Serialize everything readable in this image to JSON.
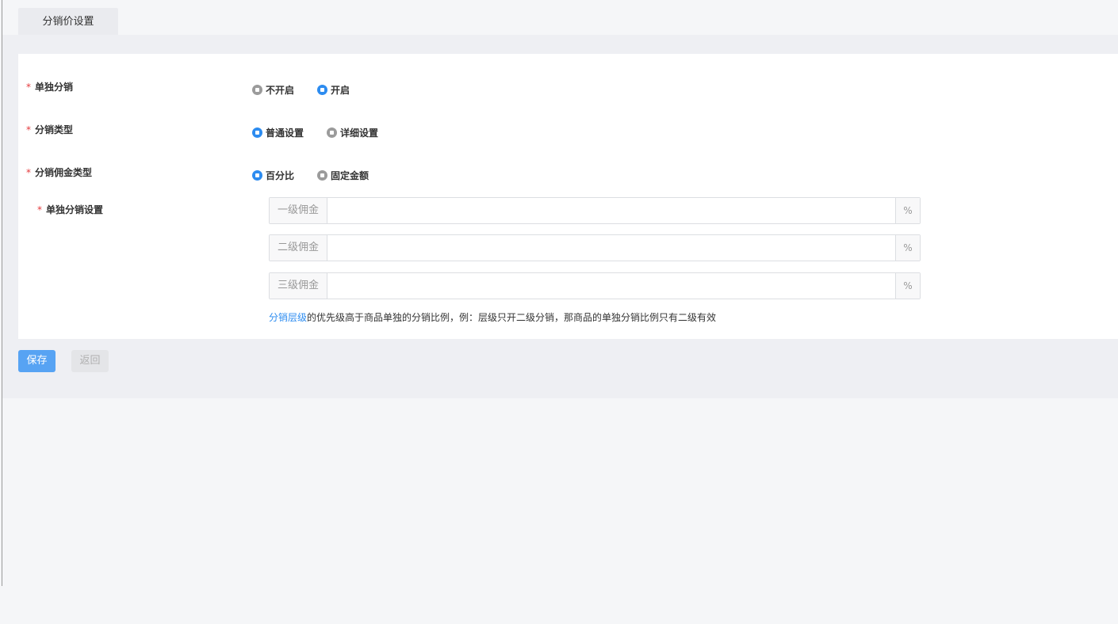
{
  "tab": {
    "label": "分销价设置"
  },
  "form": {
    "single_distribution": {
      "label": "单独分销",
      "options": [
        "不开启",
        "开启"
      ],
      "selected": "开启"
    },
    "distribution_type": {
      "label": "分销类型",
      "options": [
        "普通设置",
        "详细设置"
      ],
      "selected": "普通设置"
    },
    "commission_type": {
      "label": "分销佣金类型",
      "options": [
        "百分比",
        "固定金额"
      ],
      "selected": "百分比"
    },
    "single_settings": {
      "label": "单独分销设置",
      "levels": [
        {
          "addon": "一级佣金",
          "value": "",
          "suffix": "%"
        },
        {
          "addon": "二级佣金",
          "value": "",
          "suffix": "%"
        },
        {
          "addon": "三级佣金",
          "value": "",
          "suffix": "%"
        }
      ]
    },
    "hint": {
      "link": "分销层级",
      "text": "的优先级高于商品单独的分销比例，例：层级只开二级分销，那商品的单独分销比例只有二级有效"
    }
  },
  "buttons": {
    "save": "保存",
    "back": "返回"
  },
  "colors": {
    "primary": "#2d8cf0",
    "required": "#e4393c",
    "save_button": "#57a3f3"
  }
}
